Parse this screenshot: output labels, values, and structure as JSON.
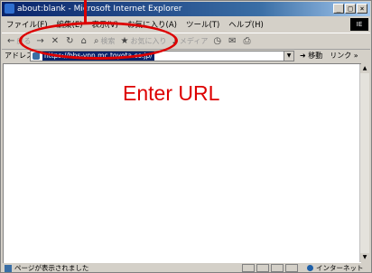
{
  "window": {
    "title": "about:blank - Microsoft Internet Explorer",
    "min_label": "_",
    "max_label": "□",
    "close_label": "×"
  },
  "menubar": {
    "items": [
      {
        "label": "ファイル(F)"
      },
      {
        "label": "編集(E)"
      },
      {
        "label": "表示(V)"
      },
      {
        "label": "お気に入り(A)"
      },
      {
        "label": "ツール(T)"
      },
      {
        "label": "ヘルプ(H)"
      }
    ],
    "throbber": "IE"
  },
  "toolbar": {
    "back_label": "戻る",
    "forward_glyph": "→",
    "stop_glyph": "✕",
    "refresh_glyph": "↻",
    "home_glyph": "⌂",
    "search_label": "検索",
    "favorites_label": "お気に入り",
    "media_label": "メディア",
    "history_glyph": "◷",
    "mail_glyph": "✉",
    "print_glyph": "⎙"
  },
  "addressbar": {
    "label": "アドレス(D)",
    "url": "https://bbs-vpn.mc.toyota.co.jp/",
    "go_label": "移動",
    "links_label": "リンク »"
  },
  "statusbar": {
    "text": "ページが表示されました",
    "zone": "インターネット"
  },
  "annotation": {
    "text": "Enter URL",
    "color": "#dd0000"
  }
}
